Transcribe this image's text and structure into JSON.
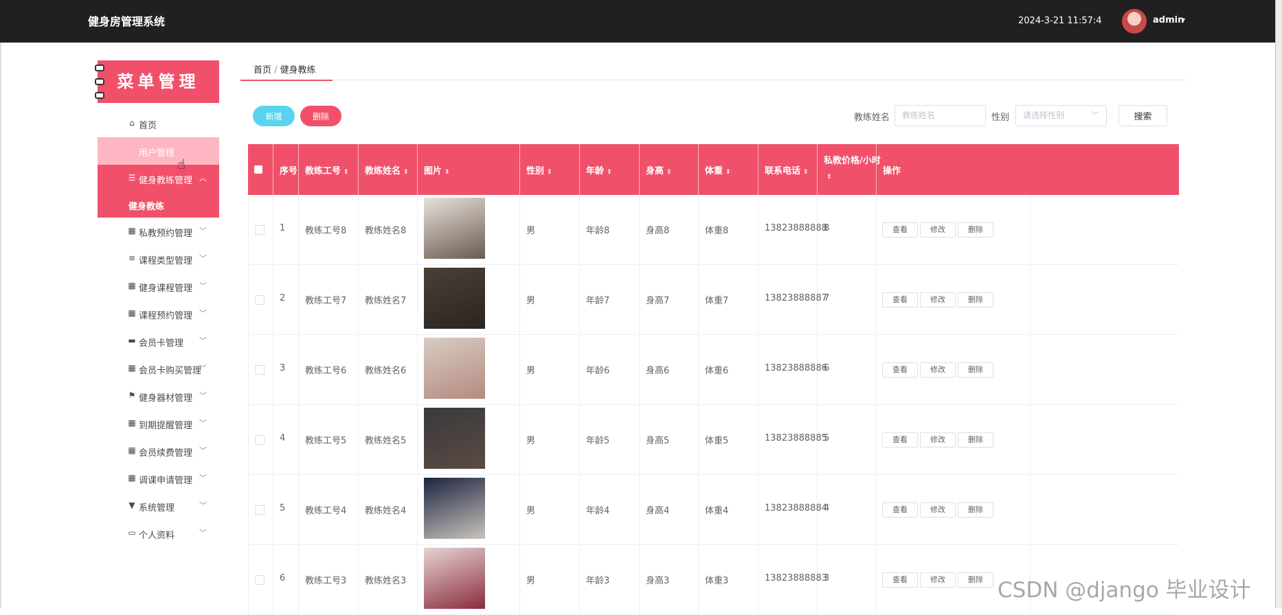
{
  "header": {
    "title": "健身房管理系统",
    "datetime": "2024-3-21 11:57:4",
    "username": "admin",
    "caret": "▾"
  },
  "sidebar": {
    "menu_title": "菜单管理",
    "items": [
      {
        "name": "home",
        "label": "首页",
        "icon": "⌂",
        "chevron": ""
      },
      {
        "name": "user-management",
        "label": "用户管理",
        "icon": "",
        "chevron": ""
      },
      {
        "name": "coach-management",
        "label": "健身教练管理",
        "icon": "☰",
        "chevron": "︿"
      }
    ],
    "active_sub": "健身教练",
    "rest": [
      {
        "label": "私教预约管理",
        "icon": "▦",
        "chevron": "﹀"
      },
      {
        "label": "课程类型管理",
        "icon": "≡",
        "chevron": "﹀"
      },
      {
        "label": "健身课程管理",
        "icon": "▦",
        "chevron": "﹀"
      },
      {
        "label": "课程预约管理",
        "icon": "▦",
        "chevron": "﹀"
      },
      {
        "label": "会员卡管理",
        "icon": "▬",
        "chevron": "﹀"
      },
      {
        "label": "会员卡购买管理",
        "icon": "▦",
        "chevron": "﹀"
      },
      {
        "label": "健身器材管理",
        "icon": "⚑",
        "chevron": "﹀"
      },
      {
        "label": "到期提醒管理",
        "icon": "▦",
        "chevron": "﹀"
      },
      {
        "label": "会员续费管理",
        "icon": "▦",
        "chevron": "﹀"
      },
      {
        "label": "调课申请管理",
        "icon": "▦",
        "chevron": "﹀"
      },
      {
        "label": "系统管理",
        "icon": "▼",
        "chevron": "﹀"
      },
      {
        "label": "个人资料",
        "icon": "▭",
        "chevron": "﹀"
      }
    ]
  },
  "breadcrumb": {
    "home": "首页",
    "sep": " / ",
    "current": "健身教练"
  },
  "toolbar": {
    "add_label": "新增",
    "delete_label": "删除",
    "name_label": "教练姓名",
    "name_placeholder": "教练姓名",
    "gender_label": "性别",
    "gender_placeholder": "请选择性别",
    "search_label": "搜索"
  },
  "table": {
    "sort_glyph": "⇕",
    "columns": [
      "序号",
      "教练工号",
      "教练姓名",
      "图片",
      "性别",
      "年龄",
      "身高",
      "体重",
      "联系电话",
      "私教价格/小时",
      "操作"
    ],
    "actions": {
      "view": "查看",
      "edit": "修改",
      "delete": "删除"
    },
    "rows": [
      {
        "index": "1",
        "coach_no": "教练工号8",
        "coach_name": "教练姓名8",
        "gender": "男",
        "age": "年龄8",
        "height": "身高8",
        "weight": "体重8",
        "phone": "13823888888",
        "price": "8",
        "photo_colors": [
          "#e8e2dc",
          "#6b5a4f"
        ]
      },
      {
        "index": "2",
        "coach_no": "教练工号7",
        "coach_name": "教练姓名7",
        "gender": "男",
        "age": "年龄7",
        "height": "身高7",
        "weight": "体重7",
        "phone": "13823888887",
        "price": "7",
        "photo_colors": [
          "#4a4038",
          "#2b2420"
        ]
      },
      {
        "index": "3",
        "coach_no": "教练工号6",
        "coach_name": "教练姓名6",
        "gender": "男",
        "age": "年龄6",
        "height": "身高6",
        "weight": "体重6",
        "phone": "13823888886",
        "price": "6",
        "photo_colors": [
          "#d8ccc4",
          "#b48a7e"
        ]
      },
      {
        "index": "4",
        "coach_no": "教练工号5",
        "coach_name": "教练姓名5",
        "gender": "男",
        "age": "年龄5",
        "height": "身高5",
        "weight": "体重5",
        "phone": "13823888885",
        "price": "5",
        "photo_colors": [
          "#3a3a3c",
          "#5a4a44"
        ]
      },
      {
        "index": "5",
        "coach_no": "教练工号4",
        "coach_name": "教练姓名4",
        "gender": "男",
        "age": "年龄4",
        "height": "身高4",
        "weight": "体重4",
        "phone": "13823888884",
        "price": "4",
        "photo_colors": [
          "#1e2440",
          "#c8c4bc"
        ]
      },
      {
        "index": "6",
        "coach_no": "教练工号3",
        "coach_name": "教练姓名3",
        "gender": "男",
        "age": "年龄3",
        "height": "身高3",
        "weight": "体重3",
        "phone": "13823888883",
        "price": "3",
        "photo_colors": [
          "#e6d4d2",
          "#8a2c3e"
        ]
      }
    ]
  },
  "watermark": "CSDN @django 毕业设计"
}
